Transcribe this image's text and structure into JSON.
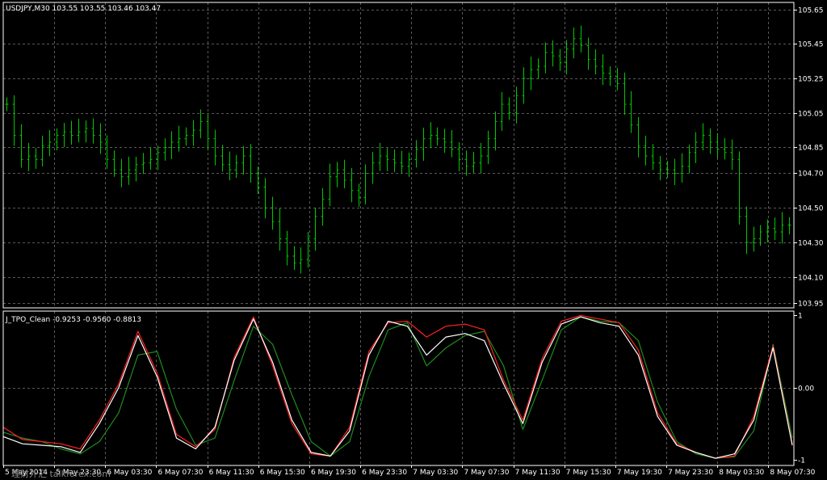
{
  "colors": {
    "background": "#000000",
    "frame": "#ffffff",
    "grid": "#5a5a5a",
    "price_bars": "#00c800",
    "tpo_red": "#ff2020",
    "tpo_white": "#ffffff",
    "tpo_green": "#1e8c1e"
  },
  "main_pane": {
    "title": "USDJPY,M30  103.55 103.55 103.46 103.47",
    "symbol": "USDJPY",
    "timeframe": "M30",
    "ohlc": [
      "103.55",
      "103.55",
      "103.46",
      "103.47"
    ],
    "y_labels": [
      "105.65",
      "105.45",
      "105.25",
      "105.05",
      "104.85",
      "104.70",
      "104.50",
      "104.30",
      "104.10",
      "103.95"
    ],
    "y_range": [
      103.92,
      105.69
    ]
  },
  "indicator_pane": {
    "title": "J_TPO_Clean -0.9253 -0.9560 -0.8813",
    "name": "J_TPO_Clean",
    "values": [
      "-0.9253",
      "-0.9560",
      "-0.8813"
    ],
    "y_labels": [
      "1",
      "0.00",
      "-1"
    ],
    "y_range": [
      -1.08,
      1.06
    ]
  },
  "x_labels": [
    "5 May 2014",
    "5 May 23:30",
    "6 May 03:30",
    "6 May 07:30",
    "6 May 11:30",
    "6 May 15:30",
    "6 May 19:30",
    "6 May 23:30",
    "7 May 03:30",
    "7 May 07:30",
    "7 May 11:30",
    "7 May 15:30",
    "7 May 19:30",
    "7 May 23:30",
    "8 May 03:30",
    "8 May 07:30"
  ],
  "watermark": "理财外汇 talkforex.com",
  "chart_data": {
    "type": "ohlc_bars",
    "close": [
      105.1,
      104.92,
      104.78,
      104.8,
      104.78,
      104.86,
      104.88,
      104.92,
      104.94,
      104.92,
      104.94,
      104.96,
      104.92,
      104.88,
      104.78,
      104.72,
      104.68,
      104.72,
      104.75,
      104.76,
      104.78,
      104.82,
      104.85,
      104.88,
      104.9,
      104.92,
      104.95,
      105.0,
      104.9,
      104.8,
      104.75,
      104.72,
      104.76,
      104.8,
      104.7,
      104.62,
      104.5,
      104.42,
      104.32,
      104.22,
      104.18,
      104.2,
      104.32,
      104.45,
      104.55,
      104.68,
      104.72,
      104.66,
      104.6,
      104.56,
      104.7,
      104.76,
      104.8,
      104.78,
      104.76,
      104.74,
      104.78,
      104.84,
      104.9,
      104.92,
      104.9,
      104.88,
      104.84,
      104.78,
      104.74,
      104.76,
      104.8,
      104.9,
      105.0,
      105.1,
      105.05,
      105.15,
      105.25,
      105.3,
      105.32,
      105.4,
      105.38,
      105.34,
      105.42,
      105.48,
      105.44,
      105.36,
      105.32,
      105.28,
      105.26,
      105.22,
      105.1,
      104.98,
      104.86,
      104.8,
      104.76,
      104.72,
      104.72,
      104.7,
      104.74,
      104.82,
      104.88,
      104.92,
      104.88,
      104.84,
      104.82,
      104.78,
      104.45,
      104.3,
      104.32,
      104.36,
      104.38,
      104.36,
      104.4,
      104.4
    ],
    "indicator": {
      "red": [
        -0.55,
        -0.72,
        -0.75,
        -0.78,
        -0.85,
        -0.45,
        0.05,
        0.78,
        0.2,
        -0.65,
        -0.82,
        -0.58,
        0.42,
        0.98,
        0.3,
        -0.5,
        -0.92,
        -0.95,
        -0.55,
        0.5,
        0.9,
        0.92,
        0.7,
        0.85,
        0.88,
        0.8,
        0.1,
        -0.45,
        0.4,
        0.92,
        1.0,
        0.95,
        0.9,
        0.52,
        -0.35,
        -0.78,
        -0.9,
        -0.98,
        -0.95,
        -0.4,
        0.58,
        -0.78
      ],
      "white": [
        -0.68,
        -0.78,
        -0.8,
        -0.82,
        -0.9,
        -0.5,
        0.0,
        0.72,
        0.15,
        -0.7,
        -0.85,
        -0.55,
        0.38,
        0.95,
        0.35,
        -0.45,
        -0.9,
        -0.95,
        -0.6,
        0.45,
        0.92,
        0.85,
        0.45,
        0.7,
        0.75,
        0.65,
        0.05,
        -0.5,
        0.35,
        0.88,
        0.98,
        0.9,
        0.85,
        0.45,
        -0.4,
        -0.8,
        -0.9,
        -0.98,
        -0.92,
        -0.45,
        0.55,
        -0.8
      ],
      "green": [
        -0.62,
        -0.7,
        -0.75,
        -0.85,
        -0.92,
        -0.75,
        -0.35,
        0.45,
        0.5,
        -0.3,
        -0.8,
        -0.7,
        0.1,
        0.85,
        0.6,
        -0.1,
        -0.75,
        -0.95,
        -0.75,
        0.15,
        0.8,
        0.9,
        0.3,
        0.55,
        0.72,
        0.78,
        0.3,
        -0.58,
        0.1,
        0.8,
        0.98,
        0.92,
        0.9,
        0.65,
        -0.2,
        -0.75,
        -0.92,
        -0.98,
        -0.96,
        -0.6,
        0.6,
        -0.7
      ]
    }
  }
}
